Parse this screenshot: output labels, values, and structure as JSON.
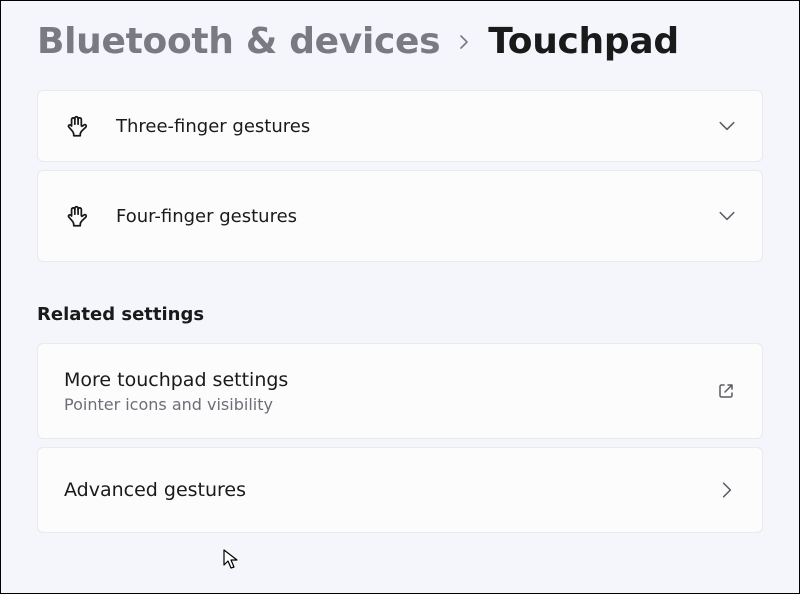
{
  "breadcrumb": {
    "parent": "Bluetooth & devices",
    "current": "Touchpad"
  },
  "gestures": {
    "three_finger_label": "Three-finger gestures",
    "four_finger_label": "Four-finger gestures"
  },
  "related": {
    "heading": "Related settings",
    "more_touchpad_title": "More touchpad settings",
    "more_touchpad_subtitle": "Pointer icons and visibility",
    "advanced_gestures_label": "Advanced gestures"
  }
}
